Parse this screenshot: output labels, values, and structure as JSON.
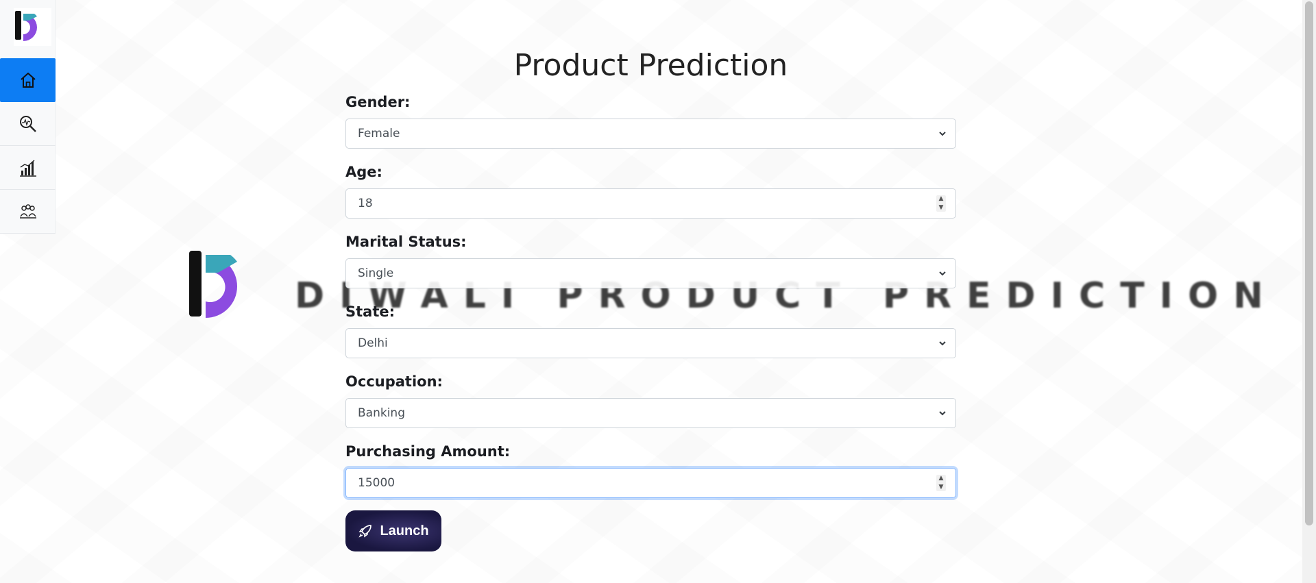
{
  "page": {
    "title": "Product Prediction"
  },
  "sidebar": {
    "logo": "brand-logo",
    "items": [
      {
        "icon": "home-icon",
        "active": true
      },
      {
        "icon": "analysis-search-icon",
        "active": false
      },
      {
        "icon": "bar-chart-icon",
        "active": false
      },
      {
        "icon": "team-icon",
        "active": false
      }
    ]
  },
  "watermark": {
    "text": "DIWALI PRODUCT PREDICTION"
  },
  "form": {
    "gender": {
      "label": "Gender:",
      "value": "Female"
    },
    "age": {
      "label": "Age:",
      "value": "18"
    },
    "marital_status": {
      "label": "Marital Status:",
      "value": "Single"
    },
    "state": {
      "label": "State:",
      "value": "Delhi"
    },
    "occupation": {
      "label": "Occupation:",
      "value": "Banking"
    },
    "purchasing_amount": {
      "label": "Purchasing Amount:",
      "value": "15000"
    },
    "submit_label": "Launch"
  },
  "colors": {
    "accent": "#0d7df3",
    "button_bg": "#1a1740",
    "focus_border": "#86b7fe"
  }
}
